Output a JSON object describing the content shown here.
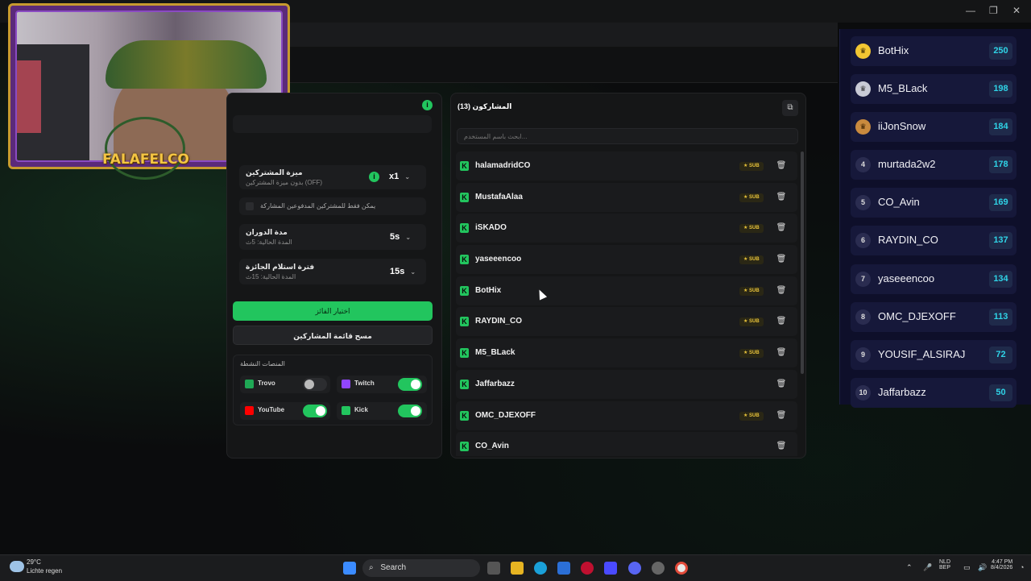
{
  "window": {
    "minimize": "—",
    "restore": "❐",
    "close": "✕"
  },
  "webcam": {
    "overlay_text": "FALAFELCO"
  },
  "settings": {
    "subs_feature_title": "ميزة المشتركين",
    "subs_feature_sub": "بدون ميزة المشتركين (OFF)",
    "multiplier_value": "x1",
    "subs_only_label": "يمكن فقط للمشتركين المدفوعين المشاركة",
    "spin_duration_title": "مدة الدوران",
    "spin_duration_sub": "المدة الحالية: 5ث",
    "spin_duration_value": "5s",
    "claim_title": "فترة استلام الجائزة",
    "claim_sub": "المدة الحالية: 15ث",
    "claim_value": "15s",
    "pick_winner_button": "اختيار الفائز",
    "clear_list_button": "مسح قائمة المشاركين",
    "platforms_title": "المنصات النشطة",
    "platforms": [
      {
        "name": "Trovo",
        "on": false,
        "color": "#1fa855"
      },
      {
        "name": "Twitch",
        "on": true,
        "color": "#9146ff"
      },
      {
        "name": "YouTube",
        "on": true,
        "color": "#ff0000"
      },
      {
        "name": "Kick",
        "on": true,
        "color": "#22c55e"
      }
    ]
  },
  "participants": {
    "title": "المشاركون (13)",
    "search_placeholder": "ابحث باسم المستخدم...",
    "sub_badge": "★ SUB",
    "items": [
      {
        "name": "halamadridCO",
        "sub": true
      },
      {
        "name": "MustafaAlaa",
        "sub": true
      },
      {
        "name": "iSKADO",
        "sub": true
      },
      {
        "name": "yaseeencoo",
        "sub": true
      },
      {
        "name": "BotHix",
        "sub": true
      },
      {
        "name": "RAYDIN_CO",
        "sub": true
      },
      {
        "name": "M5_BLack",
        "sub": true
      },
      {
        "name": "Jaffarbazz",
        "sub": false
      },
      {
        "name": "OMC_DJEXOFF",
        "sub": true
      },
      {
        "name": "CO_Avin",
        "sub": false
      }
    ]
  },
  "leaderboard": [
    {
      "rank": "",
      "name": "BotHix",
      "score": "250"
    },
    {
      "rank": "",
      "name": "M5_BLack",
      "score": "198"
    },
    {
      "rank": "",
      "name": "iiJonSnow",
      "score": "184"
    },
    {
      "rank": "4",
      "name": "murtada2w2",
      "score": "178"
    },
    {
      "rank": "5",
      "name": "CO_Avin",
      "score": "169"
    },
    {
      "rank": "6",
      "name": "RAYDIN_CO",
      "score": "137"
    },
    {
      "rank": "7",
      "name": "yaseeencoo",
      "score": "134"
    },
    {
      "rank": "8",
      "name": "OMC_DJEXOFF",
      "score": "113"
    },
    {
      "rank": "9",
      "name": "YOUSIF_ALSIRAJ",
      "score": "72"
    },
    {
      "rank": "10",
      "name": "Jaffarbazz",
      "score": "50"
    }
  ],
  "taskbar": {
    "weather_temp": "29°C",
    "weather_desc": "Lichte regen",
    "search_label": "Search",
    "lang_top": "NLD",
    "lang_bottom": "BEP",
    "time": "4:47 PM",
    "date": "8/4/2026"
  }
}
